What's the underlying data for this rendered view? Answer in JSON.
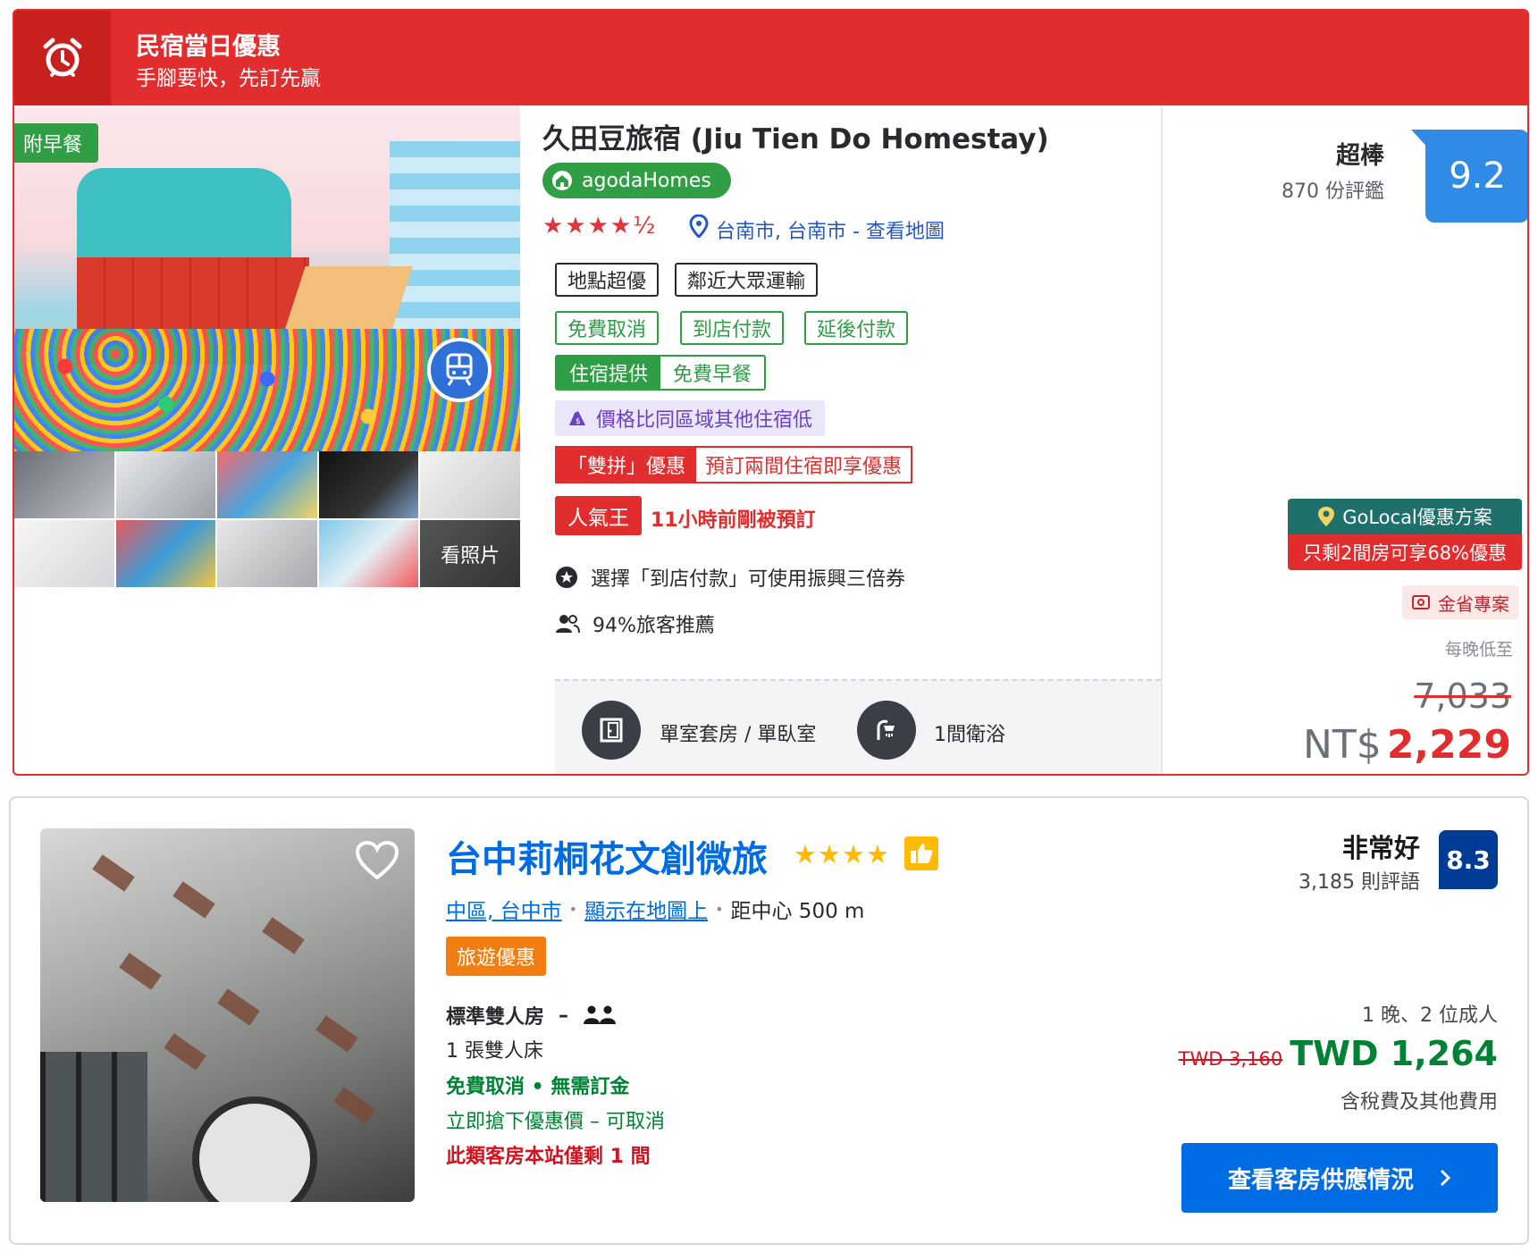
{
  "agoda": {
    "banner": {
      "title": "民宿當日優惠",
      "subtitle": "手腳要快，先訂先贏"
    },
    "breakfast_badge": "附早餐",
    "more_photos": "看照片",
    "hotel_name": "久田豆旅宿 (Jiu Tien Do Homestay)",
    "brand_badge": "agodaHomes",
    "stars": "★★★★½",
    "location": "台南市, 台南市 - 查看地圖",
    "highlight_tags": [
      "地點超優",
      "鄰近大眾運輸"
    ],
    "policy_tags": [
      "免費取消",
      "到店付款",
      "延後付款"
    ],
    "meal": {
      "label": "住宿提供",
      "value": "免費早餐"
    },
    "cheaper_tag": "價格比同區域其他住宿低",
    "duo": {
      "label": "「雙拼」優惠",
      "value": "預訂兩間住宿即享優惠"
    },
    "popular": {
      "label": "人氣王",
      "note": "11小時前剛被預訂"
    },
    "voucher_note": "選擇「到店付款」可使用振興三倍券",
    "recommend_note": "94%旅客推薦",
    "room_type": "單室套房 / 單臥室",
    "bathroom": "1間衛浴",
    "rating_word": "超棒",
    "review_count": "870 份評鑑",
    "score": "9.2",
    "golocal": "GoLocal優惠方案",
    "golocal_sub": "只剩2間房可享68%優惠",
    "saver": "金省專案",
    "per_night": "每晚低至",
    "old_price": "7,033",
    "currency": "NT$",
    "price": "2,229",
    "colors": {
      "red": "#e12d2d",
      "green": "#2f9e44",
      "blue": "#2f8be6"
    }
  },
  "booking": {
    "hotel_name": "台中莉桐花文創微旅",
    "stars": "★★★★",
    "location_area": "中區, 台中市",
    "location_map": "顯示在地圖上",
    "distance": "距中心 500 m",
    "deal_badge": "旅遊優惠",
    "room_name": "標準雙人房",
    "room_dash": "–",
    "bed": "1 張雙人床",
    "free_cancel": "免費取消 • 無需訂金",
    "grab_deal": "立即搶下優惠價 – 可取消",
    "rooms_left": "此類客房本站僅剩 1 間",
    "rating_word": "非常好",
    "review_count": "3,185 則評語",
    "score": "8.3",
    "stay_info": "1 晚、2 位成人",
    "old_price": "TWD 3,160",
    "price": "TWD 1,264",
    "tax_note": "含稅費及其他費用",
    "cta": "查看客房供應情況",
    "colors": {
      "blue": "#006ce4",
      "navy": "#003b95",
      "green": "#008234",
      "red": "#d4111e"
    }
  }
}
